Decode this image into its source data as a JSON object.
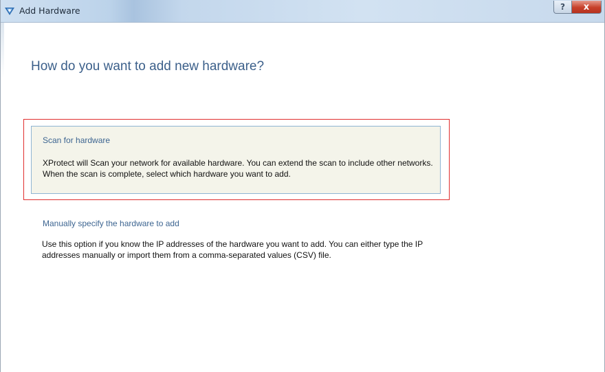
{
  "window": {
    "title": "Add Hardware",
    "help_label": "?",
    "close_label": "x"
  },
  "heading": "How do you want to add new hardware?",
  "options": [
    {
      "title": "Scan for hardware",
      "description": "XProtect will Scan your network for available hardware. You can extend the scan to include other networks. When the scan is complete, select which hardware you want to add.",
      "selected": true
    },
    {
      "title": "Manually specify the hardware to add",
      "description": "Use this option if you know the IP addresses of the hardware you want to add. You can either type the IP addresses manually or import them from a comma-separated values (CSV) file.",
      "selected": false
    }
  ],
  "colors": {
    "accent_text": "#3d6591",
    "heading": "#3b5f8a",
    "selected_bg": "#f4f4ea",
    "selected_border": "#8fb4d3",
    "highlight_frame": "#e02d2d",
    "close_button": "#c7402a"
  }
}
